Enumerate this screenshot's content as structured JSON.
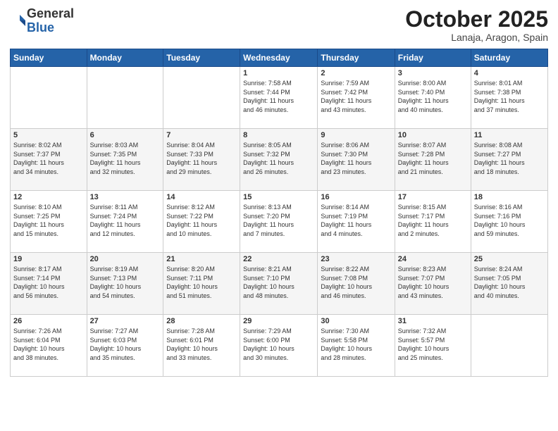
{
  "header": {
    "logo_general": "General",
    "logo_blue": "Blue",
    "month_title": "October 2025",
    "location": "Lanaja, Aragon, Spain"
  },
  "weekdays": [
    "Sunday",
    "Monday",
    "Tuesday",
    "Wednesday",
    "Thursday",
    "Friday",
    "Saturday"
  ],
  "weeks": [
    [
      {
        "day": "",
        "info": ""
      },
      {
        "day": "",
        "info": ""
      },
      {
        "day": "",
        "info": ""
      },
      {
        "day": "1",
        "info": "Sunrise: 7:58 AM\nSunset: 7:44 PM\nDaylight: 11 hours\nand 46 minutes."
      },
      {
        "day": "2",
        "info": "Sunrise: 7:59 AM\nSunset: 7:42 PM\nDaylight: 11 hours\nand 43 minutes."
      },
      {
        "day": "3",
        "info": "Sunrise: 8:00 AM\nSunset: 7:40 PM\nDaylight: 11 hours\nand 40 minutes."
      },
      {
        "day": "4",
        "info": "Sunrise: 8:01 AM\nSunset: 7:38 PM\nDaylight: 11 hours\nand 37 minutes."
      }
    ],
    [
      {
        "day": "5",
        "info": "Sunrise: 8:02 AM\nSunset: 7:37 PM\nDaylight: 11 hours\nand 34 minutes."
      },
      {
        "day": "6",
        "info": "Sunrise: 8:03 AM\nSunset: 7:35 PM\nDaylight: 11 hours\nand 32 minutes."
      },
      {
        "day": "7",
        "info": "Sunrise: 8:04 AM\nSunset: 7:33 PM\nDaylight: 11 hours\nand 29 minutes."
      },
      {
        "day": "8",
        "info": "Sunrise: 8:05 AM\nSunset: 7:32 PM\nDaylight: 11 hours\nand 26 minutes."
      },
      {
        "day": "9",
        "info": "Sunrise: 8:06 AM\nSunset: 7:30 PM\nDaylight: 11 hours\nand 23 minutes."
      },
      {
        "day": "10",
        "info": "Sunrise: 8:07 AM\nSunset: 7:28 PM\nDaylight: 11 hours\nand 21 minutes."
      },
      {
        "day": "11",
        "info": "Sunrise: 8:08 AM\nSunset: 7:27 PM\nDaylight: 11 hours\nand 18 minutes."
      }
    ],
    [
      {
        "day": "12",
        "info": "Sunrise: 8:10 AM\nSunset: 7:25 PM\nDaylight: 11 hours\nand 15 minutes."
      },
      {
        "day": "13",
        "info": "Sunrise: 8:11 AM\nSunset: 7:24 PM\nDaylight: 11 hours\nand 12 minutes."
      },
      {
        "day": "14",
        "info": "Sunrise: 8:12 AM\nSunset: 7:22 PM\nDaylight: 11 hours\nand 10 minutes."
      },
      {
        "day": "15",
        "info": "Sunrise: 8:13 AM\nSunset: 7:20 PM\nDaylight: 11 hours\nand 7 minutes."
      },
      {
        "day": "16",
        "info": "Sunrise: 8:14 AM\nSunset: 7:19 PM\nDaylight: 11 hours\nand 4 minutes."
      },
      {
        "day": "17",
        "info": "Sunrise: 8:15 AM\nSunset: 7:17 PM\nDaylight: 11 hours\nand 2 minutes."
      },
      {
        "day": "18",
        "info": "Sunrise: 8:16 AM\nSunset: 7:16 PM\nDaylight: 10 hours\nand 59 minutes."
      }
    ],
    [
      {
        "day": "19",
        "info": "Sunrise: 8:17 AM\nSunset: 7:14 PM\nDaylight: 10 hours\nand 56 minutes."
      },
      {
        "day": "20",
        "info": "Sunrise: 8:19 AM\nSunset: 7:13 PM\nDaylight: 10 hours\nand 54 minutes."
      },
      {
        "day": "21",
        "info": "Sunrise: 8:20 AM\nSunset: 7:11 PM\nDaylight: 10 hours\nand 51 minutes."
      },
      {
        "day": "22",
        "info": "Sunrise: 8:21 AM\nSunset: 7:10 PM\nDaylight: 10 hours\nand 48 minutes."
      },
      {
        "day": "23",
        "info": "Sunrise: 8:22 AM\nSunset: 7:08 PM\nDaylight: 10 hours\nand 46 minutes."
      },
      {
        "day": "24",
        "info": "Sunrise: 8:23 AM\nSunset: 7:07 PM\nDaylight: 10 hours\nand 43 minutes."
      },
      {
        "day": "25",
        "info": "Sunrise: 8:24 AM\nSunset: 7:05 PM\nDaylight: 10 hours\nand 40 minutes."
      }
    ],
    [
      {
        "day": "26",
        "info": "Sunrise: 7:26 AM\nSunset: 6:04 PM\nDaylight: 10 hours\nand 38 minutes."
      },
      {
        "day": "27",
        "info": "Sunrise: 7:27 AM\nSunset: 6:03 PM\nDaylight: 10 hours\nand 35 minutes."
      },
      {
        "day": "28",
        "info": "Sunrise: 7:28 AM\nSunset: 6:01 PM\nDaylight: 10 hours\nand 33 minutes."
      },
      {
        "day": "29",
        "info": "Sunrise: 7:29 AM\nSunset: 6:00 PM\nDaylight: 10 hours\nand 30 minutes."
      },
      {
        "day": "30",
        "info": "Sunrise: 7:30 AM\nSunset: 5:58 PM\nDaylight: 10 hours\nand 28 minutes."
      },
      {
        "day": "31",
        "info": "Sunrise: 7:32 AM\nSunset: 5:57 PM\nDaylight: 10 hours\nand 25 minutes."
      },
      {
        "day": "",
        "info": ""
      }
    ]
  ]
}
